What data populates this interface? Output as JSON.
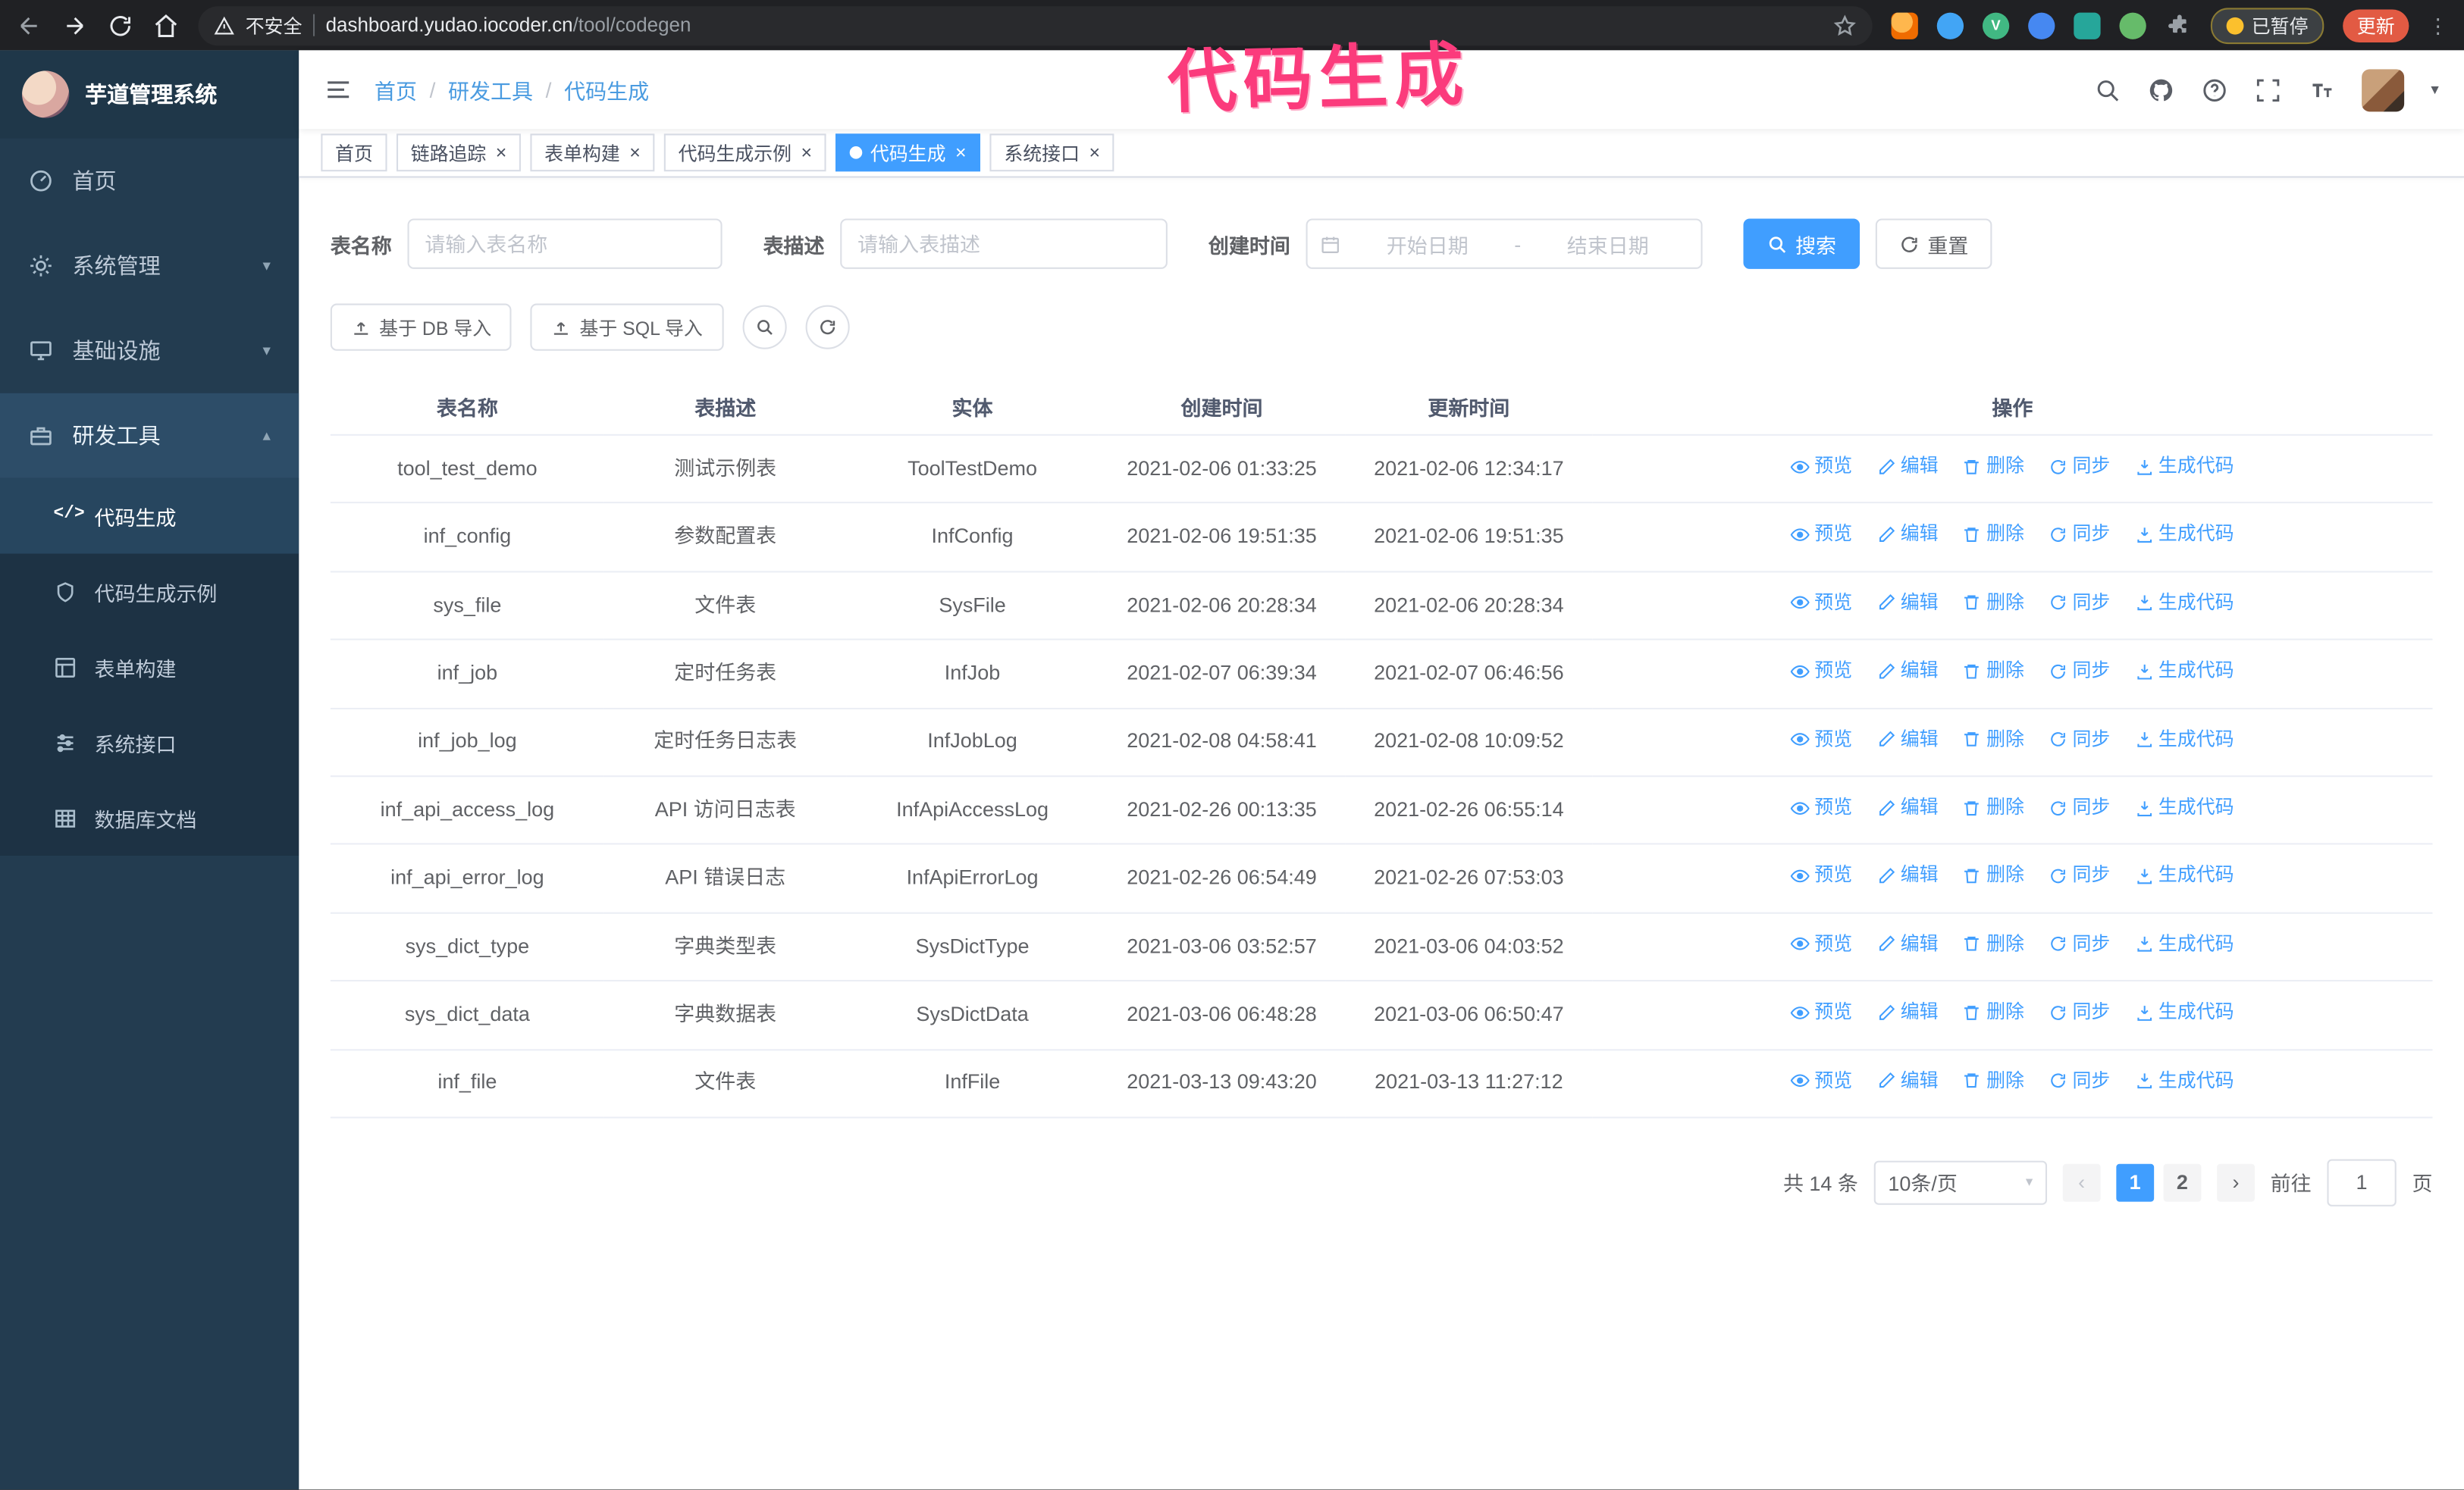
{
  "colors": {
    "accent": "#409eff",
    "sidebar_bg": "#233c50",
    "annotation_pink": "#fb3b7c",
    "update_button_bg": "#e25a43"
  },
  "browser": {
    "security_warning": "不安全",
    "url_domain": "dashboard.yudao.iocoder.cn",
    "url_path": "/tool/codegen",
    "vue_letter": "V",
    "paused_badge": "已暂停",
    "update_button": "更新"
  },
  "annotation": "代码生成",
  "app_title": "芋道管理系统",
  "breadcrumb": {
    "separator": "/",
    "items": [
      "首页",
      "研发工具",
      "代码生成"
    ]
  },
  "sidebar": {
    "items": [
      {
        "label": "首页"
      },
      {
        "label": "系统管理"
      },
      {
        "label": "基础设施"
      },
      {
        "label": "研发工具"
      }
    ],
    "subitems": [
      {
        "label": "代码生成"
      },
      {
        "label": "代码生成示例"
      },
      {
        "label": "表单构建"
      },
      {
        "label": "系统接口"
      },
      {
        "label": "数据库文档"
      }
    ]
  },
  "tabs": [
    {
      "label": "首页",
      "closable": false,
      "active": false
    },
    {
      "label": "链路追踪",
      "closable": true,
      "active": false
    },
    {
      "label": "表单构建",
      "closable": true,
      "active": false
    },
    {
      "label": "代码生成示例",
      "closable": true,
      "active": false
    },
    {
      "label": "代码生成",
      "closable": true,
      "active": true
    },
    {
      "label": "系统接口",
      "closable": true,
      "active": false
    }
  ],
  "filters": {
    "table_name_label": "表名称",
    "table_name_placeholder": "请输入表名称",
    "table_desc_label": "表描述",
    "table_desc_placeholder": "请输入表描述",
    "create_time_label": "创建时间",
    "date_start_placeholder": "开始日期",
    "date_end_placeholder": "结束日期",
    "date_separator": "-",
    "search_button": "搜索",
    "reset_button": "重置"
  },
  "toolbar": {
    "import_db": "基于 DB 导入",
    "import_sql": "基于 SQL 导入"
  },
  "table": {
    "columns": [
      "表名称",
      "表描述",
      "实体",
      "创建时间",
      "更新时间",
      "操作"
    ],
    "action_labels": [
      "预览",
      "编辑",
      "删除",
      "同步",
      "生成代码"
    ],
    "rows": [
      {
        "name": "tool_test_demo",
        "description": "测试示例表",
        "entity": "ToolTestDemo",
        "create_time": "2021-02-06 01:33:25",
        "update_time": "2021-02-06 12:34:17"
      },
      {
        "name": "inf_config",
        "description": "参数配置表",
        "entity": "InfConfig",
        "create_time": "2021-02-06 19:51:35",
        "update_time": "2021-02-06 19:51:35"
      },
      {
        "name": "sys_file",
        "description": "文件表",
        "entity": "SysFile",
        "create_time": "2021-02-06 20:28:34",
        "update_time": "2021-02-06 20:28:34"
      },
      {
        "name": "inf_job",
        "description": "定时任务表",
        "entity": "InfJob",
        "create_time": "2021-02-07 06:39:34",
        "update_time": "2021-02-07 06:46:56"
      },
      {
        "name": "inf_job_log",
        "description": "定时任务日志表",
        "entity": "InfJobLog",
        "create_time": "2021-02-08 04:58:41",
        "update_time": "2021-02-08 10:09:52"
      },
      {
        "name": "inf_api_access_log",
        "description": "API 访问日志表",
        "entity": "InfApiAccessLog",
        "create_time": "2021-02-26 00:13:35",
        "update_time": "2021-02-26 06:55:14"
      },
      {
        "name": "inf_api_error_log",
        "description": "API 错误日志",
        "entity": "InfApiErrorLog",
        "create_time": "2021-02-26 06:54:49",
        "update_time": "2021-02-26 07:53:03"
      },
      {
        "name": "sys_dict_type",
        "description": "字典类型表",
        "entity": "SysDictType",
        "create_time": "2021-03-06 03:52:57",
        "update_time": "2021-03-06 04:03:52"
      },
      {
        "name": "sys_dict_data",
        "description": "字典数据表",
        "entity": "SysDictData",
        "create_time": "2021-03-06 06:48:28",
        "update_time": "2021-03-06 06:50:47"
      },
      {
        "name": "inf_file",
        "description": "文件表",
        "entity": "InfFile",
        "create_time": "2021-03-13 09:43:20",
        "update_time": "2021-03-13 11:27:12"
      }
    ]
  },
  "pagination": {
    "total_text": "共 14 条",
    "page_size": "10条/页",
    "pages": [
      "1",
      "2"
    ],
    "active_page": "1",
    "goto_label": "前往",
    "goto_value": "1",
    "goto_suffix": "页"
  }
}
